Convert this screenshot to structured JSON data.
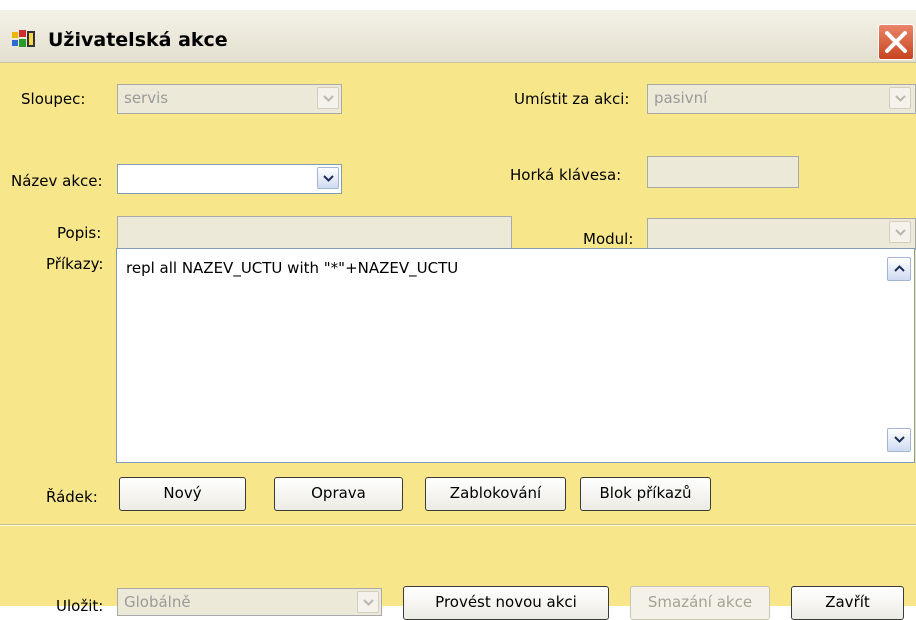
{
  "window": {
    "title": "Uživatelská akce"
  },
  "fields": {
    "sloupec": {
      "label": "Sloupec:",
      "value": "servis"
    },
    "umistit": {
      "label": "Umístit za akci:",
      "value": "pasivní"
    },
    "nazev": {
      "label": "Název akce:",
      "value": ""
    },
    "horka": {
      "label": "Horká klávesa:",
      "value": ""
    },
    "popis": {
      "label": "Popis:",
      "value": ""
    },
    "modul": {
      "label": "Modul:",
      "value": ""
    },
    "prikazy": {
      "label": "Příkazy:",
      "value": "repl all NAZEV_UCTU with \"*\"+NAZEV_UCTU"
    },
    "ulozit": {
      "label": "Uložit:",
      "value": "Globálně"
    }
  },
  "radek": {
    "label": "Řádek:",
    "buttons": {
      "novy": "Nový",
      "oprava": "Oprava",
      "zablokovani": "Zablokování",
      "blok": "Blok příkazů"
    }
  },
  "footer": {
    "provest": "Provést novou akci",
    "smazani": "Smazání akce",
    "zavrit": "Zavřít"
  },
  "icons": {
    "window": "app-icon",
    "close": "close-icon",
    "dropdown": "chevron-down-icon",
    "scroll_up": "scroll-up-icon",
    "scroll_down": "scroll-down-icon"
  },
  "colors": {
    "background": "#f7e78a",
    "close": "#c8431f"
  }
}
